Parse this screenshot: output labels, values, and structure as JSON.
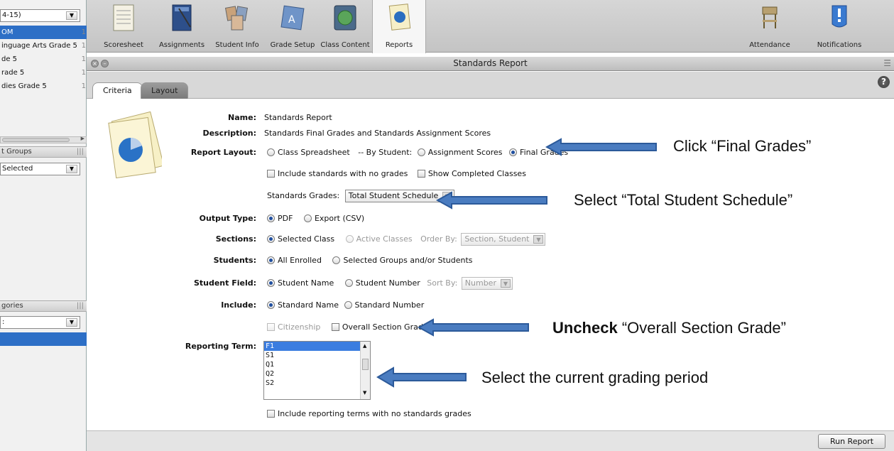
{
  "sidebar": {
    "top_select": "4-15)",
    "items": [
      {
        "label": "OM",
        "count": "1",
        "selected": true
      },
      {
        "label": "inguage Arts Grade 5",
        "count": "1"
      },
      {
        "label": "de 5",
        "count": "1"
      },
      {
        "label": "rade 5",
        "count": "1"
      },
      {
        "label": "dies Grade 5",
        "count": "1"
      }
    ],
    "groups_header": "t Groups",
    "groups_select": "Selected",
    "categories_header": "gories",
    "categories_select": ":"
  },
  "toolbar": {
    "items": [
      {
        "label": "Scoresheet",
        "icon": "scoresheet-icon"
      },
      {
        "label": "Assignments",
        "icon": "assignments-icon"
      },
      {
        "label": "Student Info",
        "icon": "student-info-icon"
      },
      {
        "label": "Grade Setup",
        "icon": "grade-setup-icon"
      },
      {
        "label": "Class Content",
        "icon": "class-content-icon"
      },
      {
        "label": "Reports",
        "icon": "reports-icon"
      }
    ],
    "right_items": [
      {
        "label": "Attendance",
        "icon": "attendance-icon"
      },
      {
        "label": "Notifications",
        "icon": "notifications-icon"
      }
    ]
  },
  "window": {
    "title": "Standards Report"
  },
  "tabs": {
    "criteria": "Criteria",
    "layout": "Layout",
    "help": "?"
  },
  "form": {
    "name_label": "Name:",
    "name_value": "Standards Report",
    "description_label": "Description:",
    "description_value": "Standards Final Grades and Standards Assignment Scores",
    "report_layout_label": "Report Layout:",
    "opt_class_spreadsheet": "Class Spreadsheet",
    "by_student_text": "-- By Student:",
    "opt_assignment_scores": "Assignment Scores",
    "opt_final_grades": "Final Grades",
    "chk_include_no_grades": "Include standards with no grades",
    "chk_show_completed": "Show Completed Classes",
    "standards_grades_label": "Standards Grades:",
    "standards_grades_value": "Total Student Schedule",
    "output_type_label": "Output Type:",
    "opt_pdf": "PDF",
    "opt_csv": "Export (CSV)",
    "sections_label": "Sections:",
    "opt_selected_class": "Selected Class",
    "opt_active_classes": "Active Classes",
    "order_by_label": "Order By:",
    "order_by_value": "Section, Student",
    "students_label": "Students:",
    "opt_all_enrolled": "All Enrolled",
    "opt_selected_groups": "Selected Groups and/or Students",
    "student_field_label": "Student Field:",
    "opt_student_name": "Student Name",
    "opt_student_number": "Student Number",
    "sort_by_label": "Sort By:",
    "sort_by_value": "Number",
    "include_label": "Include:",
    "opt_standard_name": "Standard Name",
    "opt_standard_number": "Standard Number",
    "chk_citizenship": "Citizenship",
    "chk_overall_section": "Overall Section Grade",
    "reporting_term_label": "Reporting Term:",
    "terms": [
      "F1",
      "S1",
      "Q1",
      "Q2",
      "S2"
    ],
    "chk_include_terms_no_grades": "Include reporting terms with no standards grades"
  },
  "annotations": {
    "final_grades": "Click “Final Grades”",
    "total_schedule": "Select “Total Student Schedule”",
    "uncheck_bold": "Uncheck",
    "uncheck_rest": " “Overall Section Grade”",
    "grading_period": "Select the current grading period",
    "arrow_color": "#4a7cc0"
  },
  "run_button": "Run Report"
}
